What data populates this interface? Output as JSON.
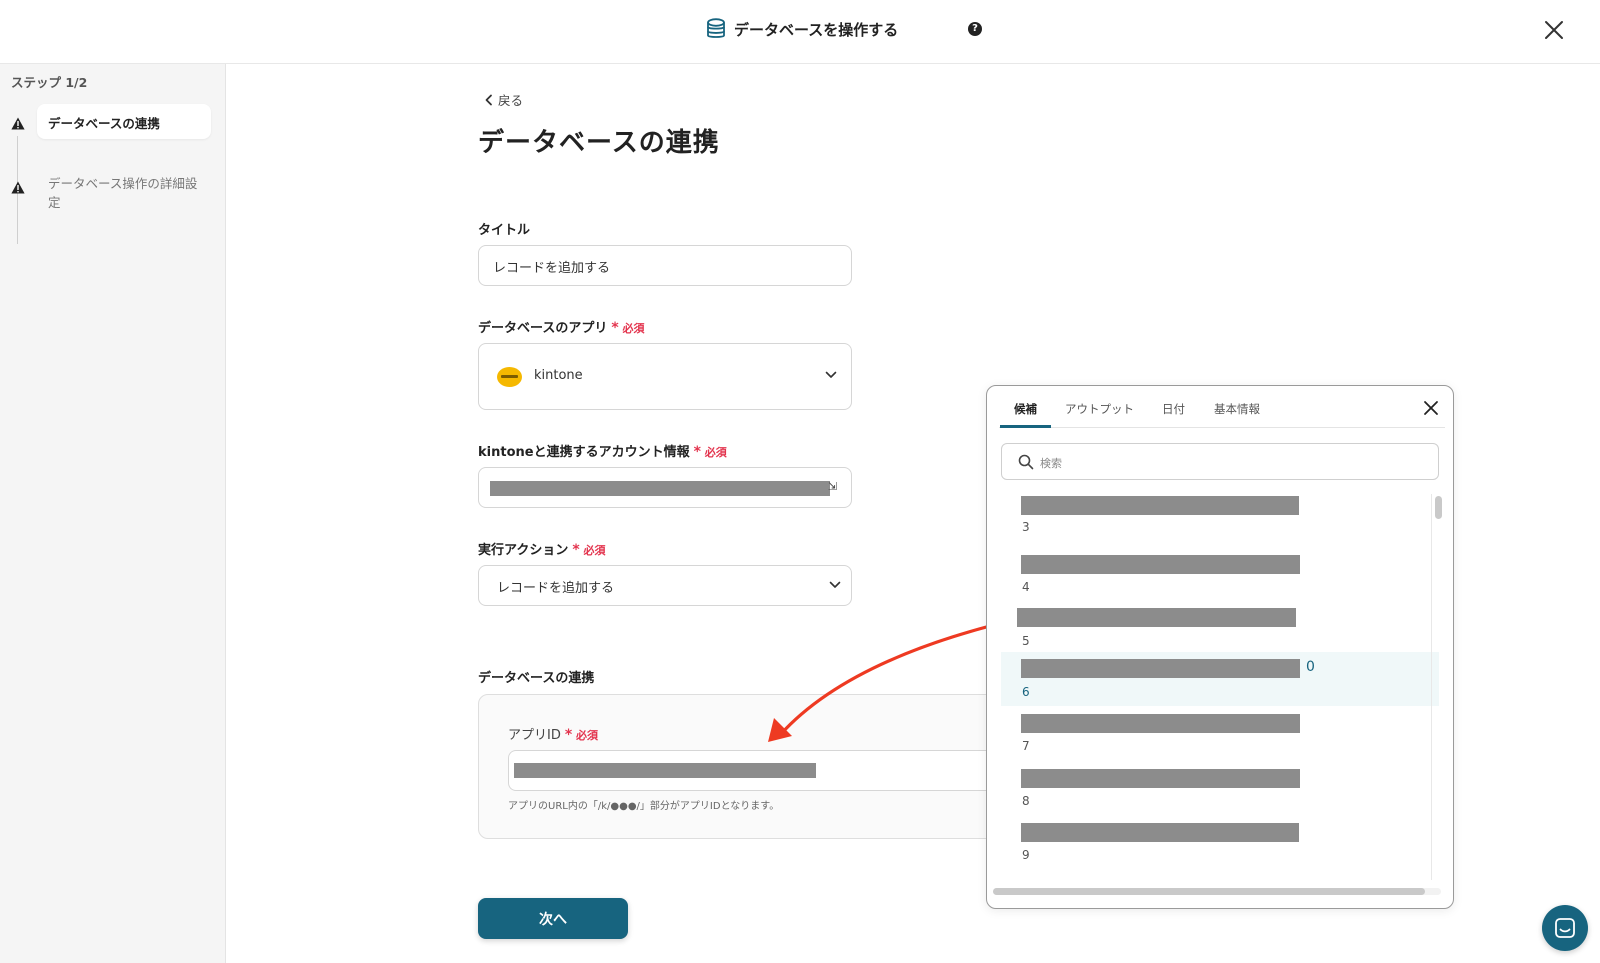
{
  "header": {
    "title": "データベースを操作する",
    "help_icon": "question-circle-icon",
    "help_glyph": "?",
    "close_icon": "close-icon"
  },
  "sidebar": {
    "step_label": "ステップ 1/2",
    "items": [
      {
        "label": "データベースの連携",
        "status": "warning",
        "active": true
      },
      {
        "label": "データベース操作の詳細設定",
        "status": "warning",
        "active": false
      }
    ]
  },
  "main": {
    "back_label": "戻る",
    "page_title": "データベースの連携",
    "required_label": "必須",
    "required_mark": "*",
    "title_field": {
      "label": "タイトル",
      "value": "レコードを追加する"
    },
    "app_field": {
      "label": "データベースのアプリ",
      "value": "kintone"
    },
    "account_field": {
      "label": "kintoneと連携するアカウント情報",
      "suffix": "⇲"
    },
    "action_field": {
      "label": "実行アクション",
      "value": "レコードを追加する"
    },
    "section_title": "データベースの連携",
    "app_id_field": {
      "label": "アプリID",
      "hint": "アプリのURL内の「/k/●●●/」部分がアプリIDとなります。"
    },
    "next_button": "次へ"
  },
  "popup": {
    "tabs": [
      "候補",
      "アウトプット",
      "日付",
      "基本情報"
    ],
    "active_tab": 0,
    "search_placeholder": "検索",
    "rows": [
      {
        "num": "3",
        "tail": ""
      },
      {
        "num": "4",
        "tail": ""
      },
      {
        "num": "5",
        "tail": ""
      },
      {
        "num": "6",
        "tail": "0",
        "highlighted": true
      },
      {
        "num": "7",
        "tail": ""
      },
      {
        "num": "8",
        "tail": ""
      },
      {
        "num": "9",
        "tail": ""
      }
    ]
  },
  "colors": {
    "accent": "#17647f",
    "required": "#e3334d",
    "annotation_arrow": "#ee3a22"
  }
}
